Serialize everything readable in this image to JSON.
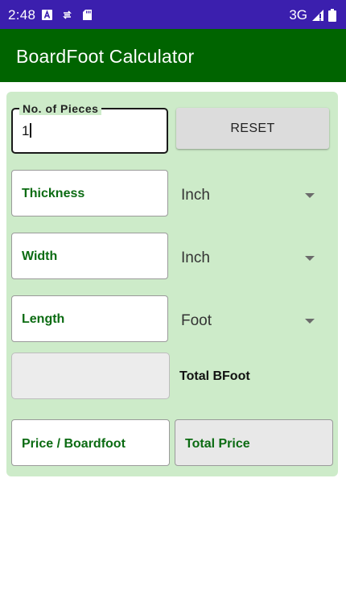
{
  "status_bar": {
    "time": "2:48",
    "network": "3G",
    "icons": [
      "a-notification-icon",
      "sync-icon",
      "sd-card-icon",
      "signal-icon",
      "battery-icon"
    ]
  },
  "app_bar": {
    "title": "BoardFoot Calculator"
  },
  "form": {
    "pieces": {
      "label": "No. of Pieces",
      "value": "1"
    },
    "reset_label": "RESET",
    "thickness": {
      "label": "Thickness",
      "unit": "Inch"
    },
    "width": {
      "label": "Width",
      "unit": "Inch"
    },
    "length": {
      "label": "Length",
      "unit": "Foot"
    },
    "total_bfoot": {
      "value": "",
      "label": "Total BFoot"
    },
    "price": {
      "label": "Price / Boardfoot"
    },
    "total_price": {
      "label": "Total Price"
    }
  },
  "colors": {
    "status_bar": "#3b1fae",
    "app_bar": "#006400",
    "panel": "#cdebc9",
    "label_green": "#0b6b12"
  }
}
